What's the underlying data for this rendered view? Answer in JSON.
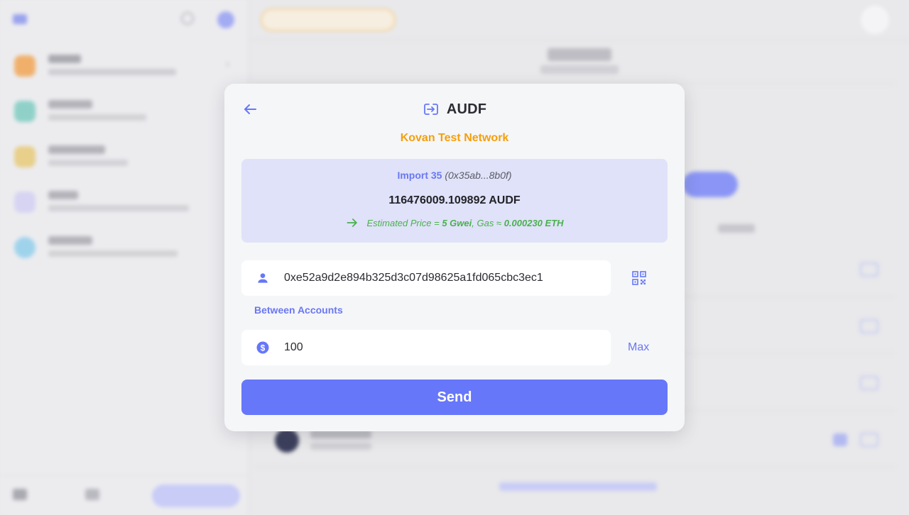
{
  "modal": {
    "title": "AUDF",
    "network": "Kovan Test Network",
    "account_name": "Import 35",
    "account_address": "(0x35ab...8b0f)",
    "balance": "116476009.109892 AUDF",
    "estimated_price_prefix": "Estimated Price = ",
    "estimated_price_value": "5 Gwei",
    "gas_prefix": ", Gas ≈ ",
    "gas_value": "0.000230 ETH",
    "recipient_value": "0xe52a9d2e894b325d3c07d98625a1fd065cbc3ec1",
    "between_accounts_label": "Between Accounts",
    "amount_value": "100",
    "max_label": "Max",
    "send_label": "Send"
  },
  "icons": {
    "back": "arrow-left-icon",
    "title": "transfer-in-icon",
    "estimate": "arrow-right-icon",
    "recipient": "person-icon",
    "qr": "qr-code-icon",
    "amount": "dollar-circle-icon"
  },
  "colors": {
    "accent": "#6677fa",
    "link": "#6a77f3",
    "network": "#f59f0c",
    "success": "#4caf50",
    "info_bg": "#dfe2f8"
  }
}
